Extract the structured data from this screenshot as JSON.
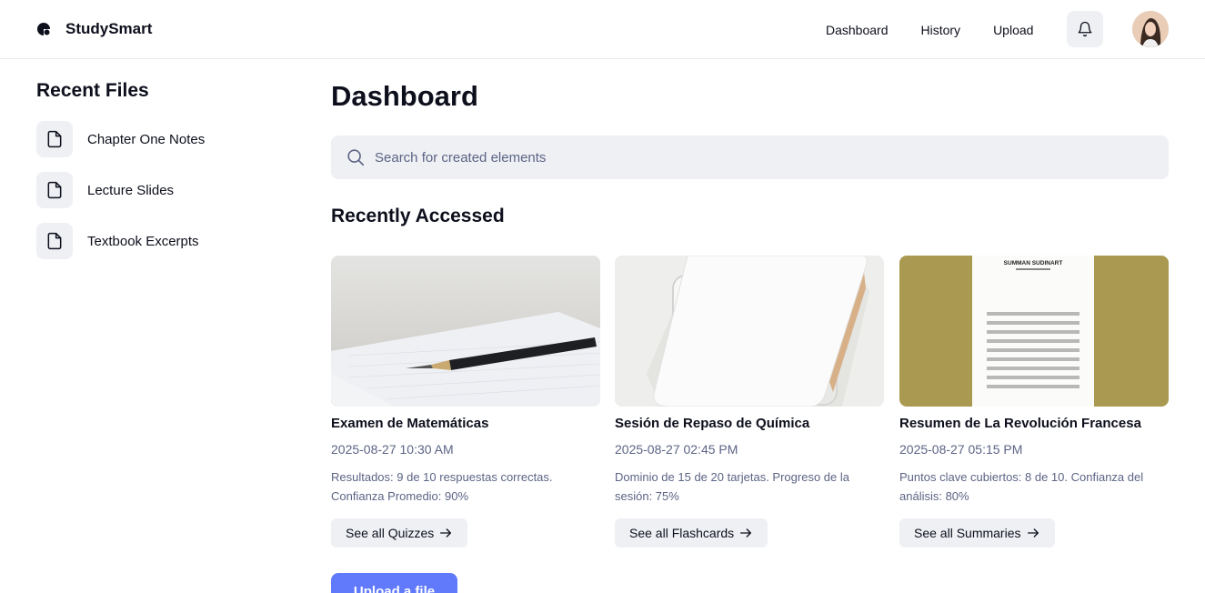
{
  "app": {
    "name": "StudySmart"
  },
  "nav": {
    "items": [
      "Dashboard",
      "History",
      "Upload"
    ]
  },
  "icons": {
    "notifications": "bell-icon",
    "file": "file-icon",
    "search": "search-icon",
    "arrow": "arrow-right-icon"
  },
  "colors": {
    "accent": "#607afb",
    "muted_bg": "#eef0f4",
    "muted_text": "#5c6485"
  },
  "sidebar": {
    "title": "Recent Files",
    "items": [
      {
        "label": "Chapter One Notes"
      },
      {
        "label": "Lecture Slides"
      },
      {
        "label": "Textbook Excerpts"
      }
    ]
  },
  "main": {
    "title": "Dashboard",
    "search": {
      "placeholder": "Search for created elements",
      "value": ""
    },
    "recent_title": "Recently Accessed",
    "cards": [
      {
        "title": "Examen de Matemáticas",
        "date": "2025-08-27 10:30 AM",
        "description": "Resultados: 9 de 10 respuestas correctas. Confianza Promedio: 90%",
        "button": "See all Quizzes"
      },
      {
        "title": "Sesión de Repaso de Química",
        "date": "2025-08-27 02:45 PM",
        "description": "Dominio de 15 de 20 tarjetas. Progreso de la sesión: 75%",
        "button": "See all Flashcards"
      },
      {
        "title": "Resumen de La Revolución Francesa",
        "date": "2025-08-27 05:15 PM",
        "description": "Puntos clave cubiertos: 8 de 10. Confianza del análisis: 80%",
        "button": "See all Summaries",
        "image_text": "SUMMAN SUDINART"
      }
    ],
    "upload_button": "Upload a file"
  }
}
